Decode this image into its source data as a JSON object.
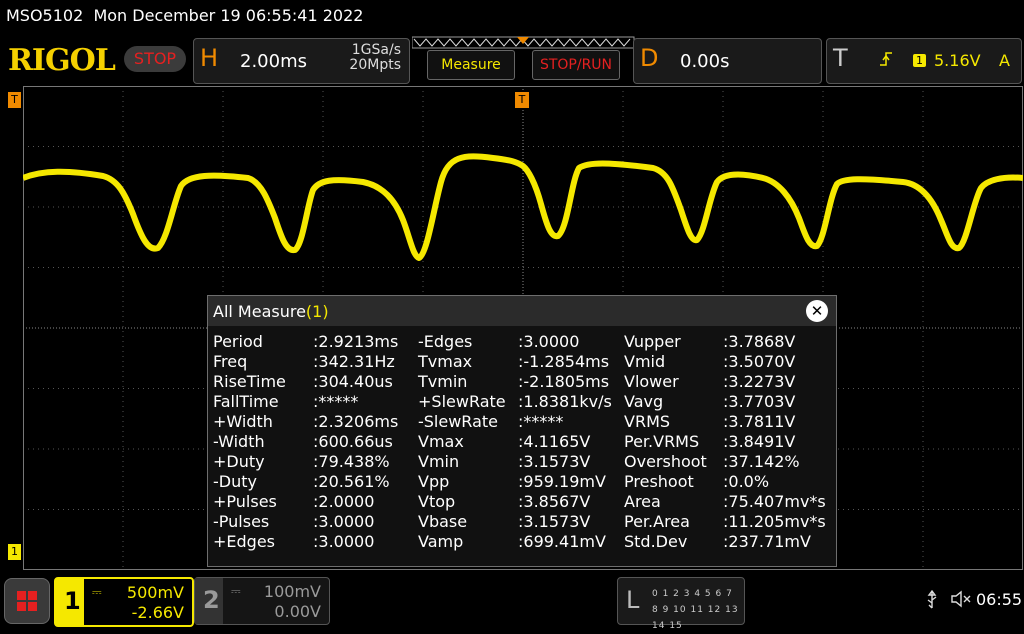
{
  "status_bar": {
    "model": "MSO5102",
    "datetime": "Mon December 19 06:55:41 2022"
  },
  "toolbar": {
    "logo": "RIGOL",
    "run_state": "STOP",
    "horizontal": {
      "letter": "H",
      "timebase": "2.00ms",
      "sample_rate": "1GSa/s",
      "memory_depth": "20Mpts"
    },
    "measure_button": "Measure",
    "stoprun_button": "STOP/RUN",
    "delay": {
      "letter": "D",
      "value": "0.00s"
    },
    "trigger": {
      "letter": "T",
      "source_badge": "1",
      "level": "5.16V",
      "mode": "A"
    }
  },
  "markers": {
    "ch1_level_left": "1",
    "trigger_pos_top": "T",
    "trigger_level_left": "T"
  },
  "measure_panel": {
    "title": "All Measure",
    "count": "(1)",
    "rows": [
      [
        [
          "Period",
          ":2.9213ms"
        ],
        [
          "-Edges",
          ":3.0000"
        ],
        [
          "Vupper",
          ":3.7868V"
        ]
      ],
      [
        [
          "Freq",
          ":342.31Hz"
        ],
        [
          "Tvmax",
          ":-1.2854ms"
        ],
        [
          "Vmid",
          ":3.5070V"
        ]
      ],
      [
        [
          "RiseTime",
          ":304.40us"
        ],
        [
          "Tvmin",
          ":-2.1805ms"
        ],
        [
          "Vlower",
          ":3.2273V"
        ]
      ],
      [
        [
          "FallTime",
          ":*****"
        ],
        [
          "+SlewRate",
          ":1.8381kv/s"
        ],
        [
          "Vavg",
          ":3.7703V"
        ]
      ],
      [
        [
          "+Width",
          ":2.3206ms"
        ],
        [
          "-SlewRate",
          ":*****"
        ],
        [
          "VRMS",
          ":3.7811V"
        ]
      ],
      [
        [
          "-Width",
          ":600.66us"
        ],
        [
          "Vmax",
          ":4.1165V"
        ],
        [
          "Per.VRMS",
          ":3.8491V"
        ]
      ],
      [
        [
          "+Duty",
          ":79.438%"
        ],
        [
          "Vmin",
          ":3.1573V"
        ],
        [
          "Overshoot",
          ":37.142%"
        ]
      ],
      [
        [
          "-Duty",
          ":20.561%"
        ],
        [
          "Vpp",
          ":959.19mV"
        ],
        [
          "Preshoot",
          ":0.0%"
        ]
      ],
      [
        [
          "+Pulses",
          ":2.0000"
        ],
        [
          "Vtop",
          ":3.8567V"
        ],
        [
          "Area",
          ":75.407mv*s"
        ]
      ],
      [
        [
          "-Pulses",
          ":3.0000"
        ],
        [
          "Vbase",
          ":3.1573V"
        ],
        [
          "Per.Area",
          ":11.205mv*s"
        ]
      ],
      [
        [
          "+Edges",
          ":3.0000"
        ],
        [
          "Vamp",
          ":699.41mV"
        ],
        [
          "Std.Dev",
          ":237.71mV"
        ]
      ]
    ]
  },
  "channels": [
    {
      "num": "1",
      "scale": "500mV",
      "offset": "-2.66V",
      "color": "#f5e800",
      "active": true
    },
    {
      "num": "2",
      "scale": "100mV",
      "offset": "0.00V",
      "color": "#9a9a9a",
      "active": false
    }
  ],
  "la_panel": {
    "letter": "L",
    "row1": "0 1 2 3  4 5 6 7",
    "row2": "8 9 10 11 12 13 14 15"
  },
  "system": {
    "usb_icon": "usb-icon",
    "sound_icon": "speaker-muted-icon",
    "time": "06:55"
  }
}
